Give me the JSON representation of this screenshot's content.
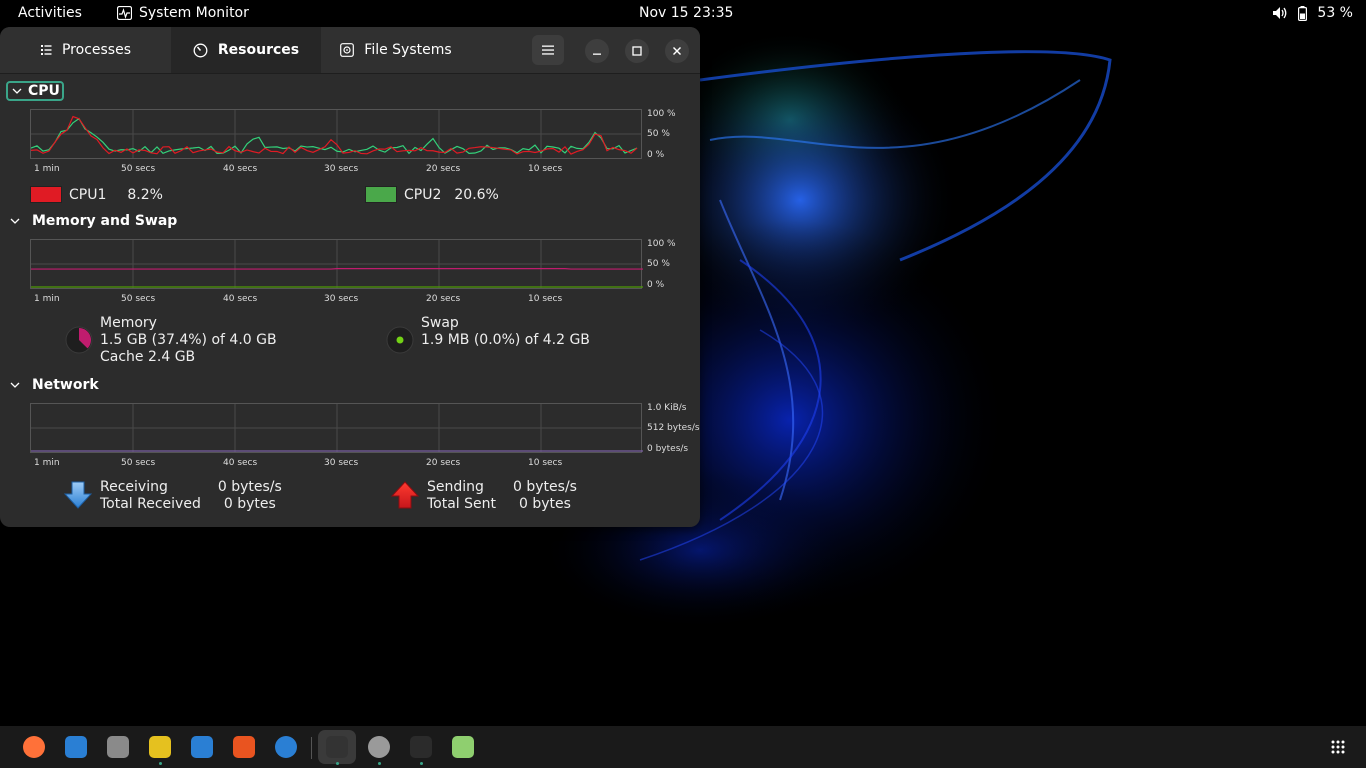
{
  "topbar": {
    "activities": "Activities",
    "app_name": "System Monitor",
    "clock": "Nov 15  23:35",
    "battery_percent": "53 %"
  },
  "window": {
    "tabs": [
      {
        "label": "Processes",
        "icon": "list-icon",
        "active": false
      },
      {
        "label": "Resources",
        "icon": "gauge-icon",
        "active": true
      },
      {
        "label": "File Systems",
        "icon": "disk-icon",
        "active": false
      }
    ]
  },
  "graph_time_labels": [
    "1 min",
    "50 secs",
    "40 secs",
    "30 secs",
    "20 secs",
    "10 secs"
  ],
  "cpu": {
    "title": "CPU",
    "y_labels": [
      "100 %",
      "50 %",
      "0 %"
    ],
    "cpus": [
      {
        "name": "CPU1",
        "value": "8.2%",
        "color": "#e01b24"
      },
      {
        "name": "CPU2",
        "value": "20.6%",
        "color": "#33d17a"
      }
    ]
  },
  "memory": {
    "title": "Memory and Swap",
    "y_labels": [
      "100 %",
      "50 %",
      "0 %"
    ],
    "memory_label": "Memory",
    "memory_usage": "1.5 GB (37.4%) of 4.0 GB",
    "memory_cache": "Cache 2.4 GB",
    "memory_fraction": 0.374,
    "memory_color": "#c01c6e",
    "swap_label": "Swap",
    "swap_usage": "1.9 MB (0.0%) of 4.2 GB",
    "swap_color": "#4e9a06"
  },
  "network": {
    "title": "Network",
    "y_labels": [
      "1.0 KiB/s",
      "512 bytes/s",
      "0 bytes/s"
    ],
    "receiving_label": "Receiving",
    "receiving_value": "0 bytes/s",
    "total_received_label": "Total Received",
    "total_received_value": "0 bytes",
    "sending_label": "Sending",
    "sending_value": "0 bytes/s",
    "total_sent_label": "Total Sent",
    "total_sent_value": "0 bytes"
  },
  "dock": {
    "items": [
      {
        "name": "firefox-icon",
        "color": "#ff7139",
        "running": false
      },
      {
        "name": "thunderbird-icon",
        "color": "#2a7fd4",
        "running": false
      },
      {
        "name": "files-icon",
        "color": "#8a8a8a",
        "running": false
      },
      {
        "name": "rhythmbox-icon",
        "color": "#e5c11f",
        "running": true
      },
      {
        "name": "writer-icon",
        "color": "#2a7fd4",
        "running": false
      },
      {
        "name": "app-center-icon",
        "color": "#e95420",
        "running": false
      },
      {
        "name": "help-icon",
        "color": "#2a7fd4",
        "running": false
      },
      {
        "name": "system-monitor-icon",
        "color": "#333333",
        "running": true
      },
      {
        "name": "settings-icon",
        "color": "#9a9a9a",
        "running": true
      },
      {
        "name": "terminal-icon",
        "color": "#2b2b2b",
        "running": true
      },
      {
        "name": "trash-icon",
        "color": "#8fcf6f",
        "running": false
      }
    ]
  }
}
